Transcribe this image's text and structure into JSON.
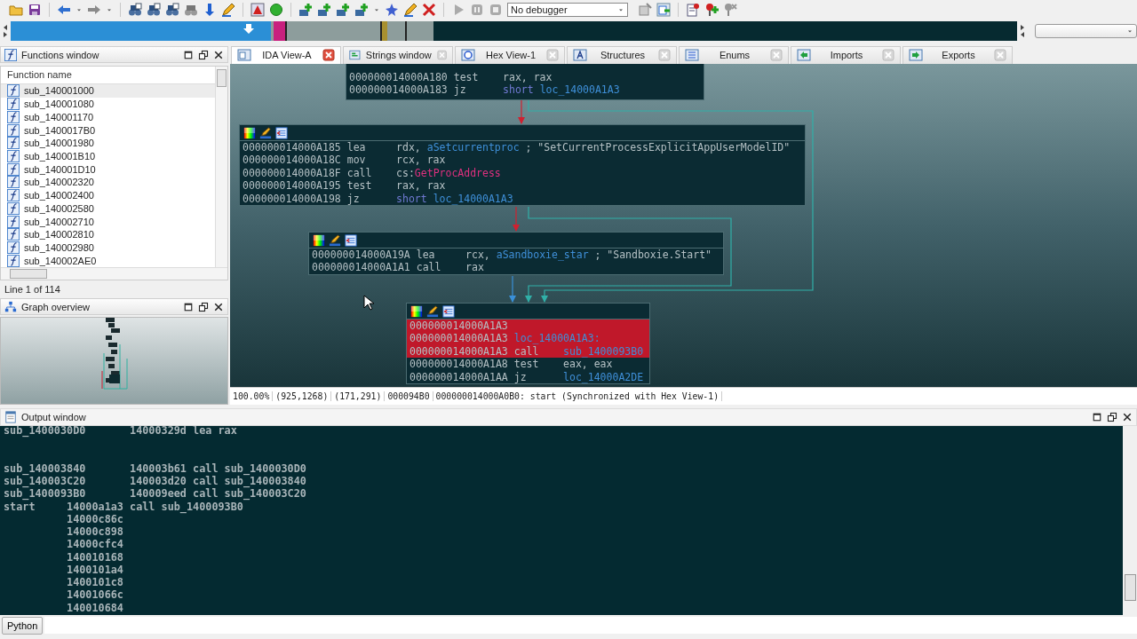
{
  "toolbar": {
    "debugger": "No debugger"
  },
  "functions_window": {
    "title": "Functions window",
    "column": "Function name",
    "functions": [
      {
        "name": "sub_140001000",
        "selected": true
      },
      {
        "name": "sub_140001080",
        "selected": false
      },
      {
        "name": "sub_140001170",
        "selected": false
      },
      {
        "name": "sub_1400017B0",
        "selected": false
      },
      {
        "name": "sub_140001980",
        "selected": false
      },
      {
        "name": "sub_140001B10",
        "selected": false
      },
      {
        "name": "sub_140001D10",
        "selected": false
      },
      {
        "name": "sub_140002320",
        "selected": false
      },
      {
        "name": "sub_140002400",
        "selected": false
      },
      {
        "name": "sub_140002580",
        "selected": false
      },
      {
        "name": "sub_140002710",
        "selected": false
      },
      {
        "name": "sub_140002810",
        "selected": false
      },
      {
        "name": "sub_140002980",
        "selected": false
      },
      {
        "name": "sub_140002AE0",
        "selected": false
      }
    ],
    "status": "Line 1 of 114"
  },
  "graph_overview": {
    "title": "Graph overview"
  },
  "tabs": [
    {
      "label": "IDA View-A",
      "selected": true
    },
    {
      "label": "Strings window",
      "selected": false
    },
    {
      "label": "Hex View-1",
      "selected": false
    },
    {
      "label": "Structures",
      "selected": false
    },
    {
      "label": "Enums",
      "selected": false
    },
    {
      "label": "Imports",
      "selected": false
    },
    {
      "label": "Exports",
      "selected": false
    }
  ],
  "graph": {
    "nodes": [
      {
        "toolbar": false,
        "lines": [
          {
            "address": "000000014000A180",
            "mnemonic": "test",
            "operands": [
              {
                "text": "rax, rax",
                "kind": "plain"
              }
            ],
            "highlighted": false
          },
          {
            "address": "000000014000A183",
            "mnemonic": "jz",
            "operands": [
              {
                "text": "short ",
                "kind": "keyword"
              },
              {
                "text": "loc_14000A1A3",
                "kind": "name"
              }
            ],
            "highlighted": false
          }
        ]
      },
      {
        "toolbar": true,
        "lines": [
          {
            "address": "000000014000A185",
            "mnemonic": "lea",
            "operands": [
              {
                "text": "rdx, ",
                "kind": "plain"
              },
              {
                "text": "aSetcurrentproc",
                "kind": "name"
              },
              {
                "text": " ; \"SetCurrentProcessExplicitAppUserModelID\"",
                "kind": "plain"
              }
            ],
            "highlighted": false
          },
          {
            "address": "000000014000A18C",
            "mnemonic": "mov",
            "operands": [
              {
                "text": "rcx, rax",
                "kind": "plain"
              }
            ],
            "highlighted": false
          },
          {
            "address": "000000014000A18F",
            "mnemonic": "call",
            "operands": [
              {
                "text": "cs:",
                "kind": "plain"
              },
              {
                "text": "GetProcAddress",
                "kind": "import"
              }
            ],
            "highlighted": false
          },
          {
            "address": "000000014000A195",
            "mnemonic": "test",
            "operands": [
              {
                "text": "rax, rax",
                "kind": "plain"
              }
            ],
            "highlighted": false
          },
          {
            "address": "000000014000A198",
            "mnemonic": "jz",
            "operands": [
              {
                "text": "short ",
                "kind": "keyword"
              },
              {
                "text": "loc_14000A1A3",
                "kind": "name"
              }
            ],
            "highlighted": false
          }
        ]
      },
      {
        "toolbar": true,
        "lines": [
          {
            "address": "000000014000A19A",
            "mnemonic": "lea",
            "operands": [
              {
                "text": "rcx, ",
                "kind": "plain"
              },
              {
                "text": "aSandboxie_star",
                "kind": "name"
              },
              {
                "text": " ; \"Sandboxie.Start\"",
                "kind": "plain"
              }
            ],
            "highlighted": false
          },
          {
            "address": "000000014000A1A1",
            "mnemonic": "call",
            "operands": [
              {
                "text": "rax",
                "kind": "plain"
              }
            ],
            "highlighted": false
          }
        ]
      },
      {
        "toolbar": true,
        "lines": [
          {
            "address": "000000014000A1A3",
            "highlighted": true
          },
          {
            "address": "000000014000A1A3",
            "label": "loc_14000A1A3:",
            "highlighted": true
          },
          {
            "address": "000000014000A1A3",
            "mnemonic": "call",
            "operands": [
              {
                "text": "sub_1400093B0",
                "kind": "name"
              }
            ],
            "highlighted": true
          },
          {
            "address": "000000014000A1A8",
            "mnemonic": "test",
            "operands": [
              {
                "text": "eax, eax",
                "kind": "plain"
              }
            ],
            "highlighted": false
          },
          {
            "address": "000000014000A1AA",
            "mnemonic": "jz",
            "operands": [
              {
                "text": "loc_14000A2DE",
                "kind": "name"
              }
            ],
            "highlighted": false
          }
        ]
      }
    ],
    "status": [
      "100.00%",
      "(925,1268)",
      "(171,291)",
      "000094B0",
      "000000014000A0B0: start (Synchronized with Hex View-1)"
    ]
  },
  "output_window": {
    "title": "Output window",
    "text": "sub_1400030D0       14000329d lea rax\n\n\nsub_140003840       140003b61 call sub_1400030D0\nsub_140003C20       140003d20 call sub_140003840\nsub_1400093B0       140009eed call sub_140003C20\nstart     14000a1a3 call sub_1400093B0\n          14000c86c\n          14000c898\n          14000cfc4\n          140010168\n          1400101a4\n          1400101c8\n          14001066c\n          140010684"
  },
  "python": {
    "button": "Python"
  }
}
